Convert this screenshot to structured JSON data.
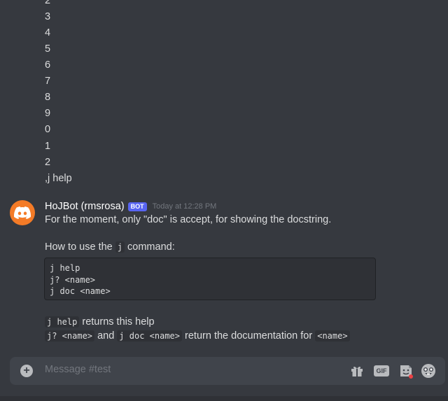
{
  "previous_lines": [
    "2",
    "3",
    "4",
    "5",
    "6",
    "7",
    "8",
    "9",
    "0",
    "1",
    "2",
    ",j help"
  ],
  "message": {
    "author": "HoJBot (rmsrosa)",
    "badge": "BOT",
    "timestamp": "Today at 12:28 PM",
    "line1": "For the moment, only \"doc\" is accept, for showing the docstring.",
    "howto_prefix": "How to use the",
    "howto_code": "j",
    "howto_suffix": "command:",
    "code_block": "j help\nj? <name>\nj doc <name>",
    "help_code": "j help",
    "help_text": "returns this help",
    "doc_code1": "j? <name>",
    "doc_and": "and",
    "doc_code2": "j doc <name>",
    "doc_text": "return the documentation for",
    "doc_code3": "<name>"
  },
  "composer": {
    "placeholder": "Message #test",
    "gif_label": "GIF",
    "icons": [
      "plus-circle-icon",
      "gift-icon",
      "gif-icon",
      "sticker-icon",
      "emoji-icon"
    ]
  },
  "colors": {
    "background": "#36393f",
    "avatar": "#f47b27",
    "bot_badge": "#5865f2",
    "composer": "#40444b"
  }
}
